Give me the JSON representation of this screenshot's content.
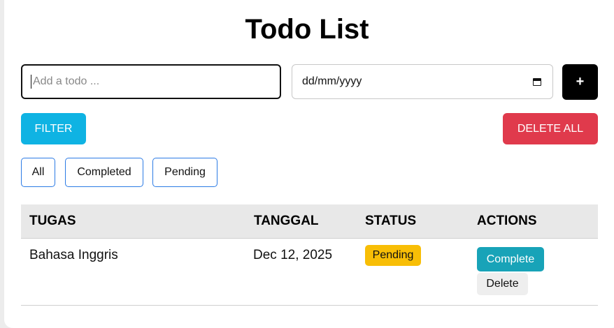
{
  "header": {
    "title": "Todo List"
  },
  "form": {
    "todo_placeholder": "Add a todo ...",
    "date_placeholder": "dd/mm/yyyy",
    "add_label": "+"
  },
  "toolbar": {
    "filter_label": "FILTER",
    "delete_all_label": "DELETE ALL"
  },
  "filters": [
    "All",
    "Completed",
    "Pending"
  ],
  "table": {
    "headers": [
      "TUGAS",
      "TANGGAL",
      "STATUS",
      "ACTIONS"
    ],
    "rows": [
      {
        "task": "Bahasa Inggris",
        "date": "Dec 12, 2025",
        "status": "Pending",
        "actions": [
          "Complete",
          "Delete"
        ]
      }
    ]
  },
  "colors": {
    "filter": "#0fb3e3",
    "delete_all": "#e03a4c",
    "pending_badge": "#f8be06",
    "complete_button": "#18a3b8",
    "chip_border": "#2c7be5"
  },
  "icons": {
    "date_picker": "calendar-icon"
  }
}
